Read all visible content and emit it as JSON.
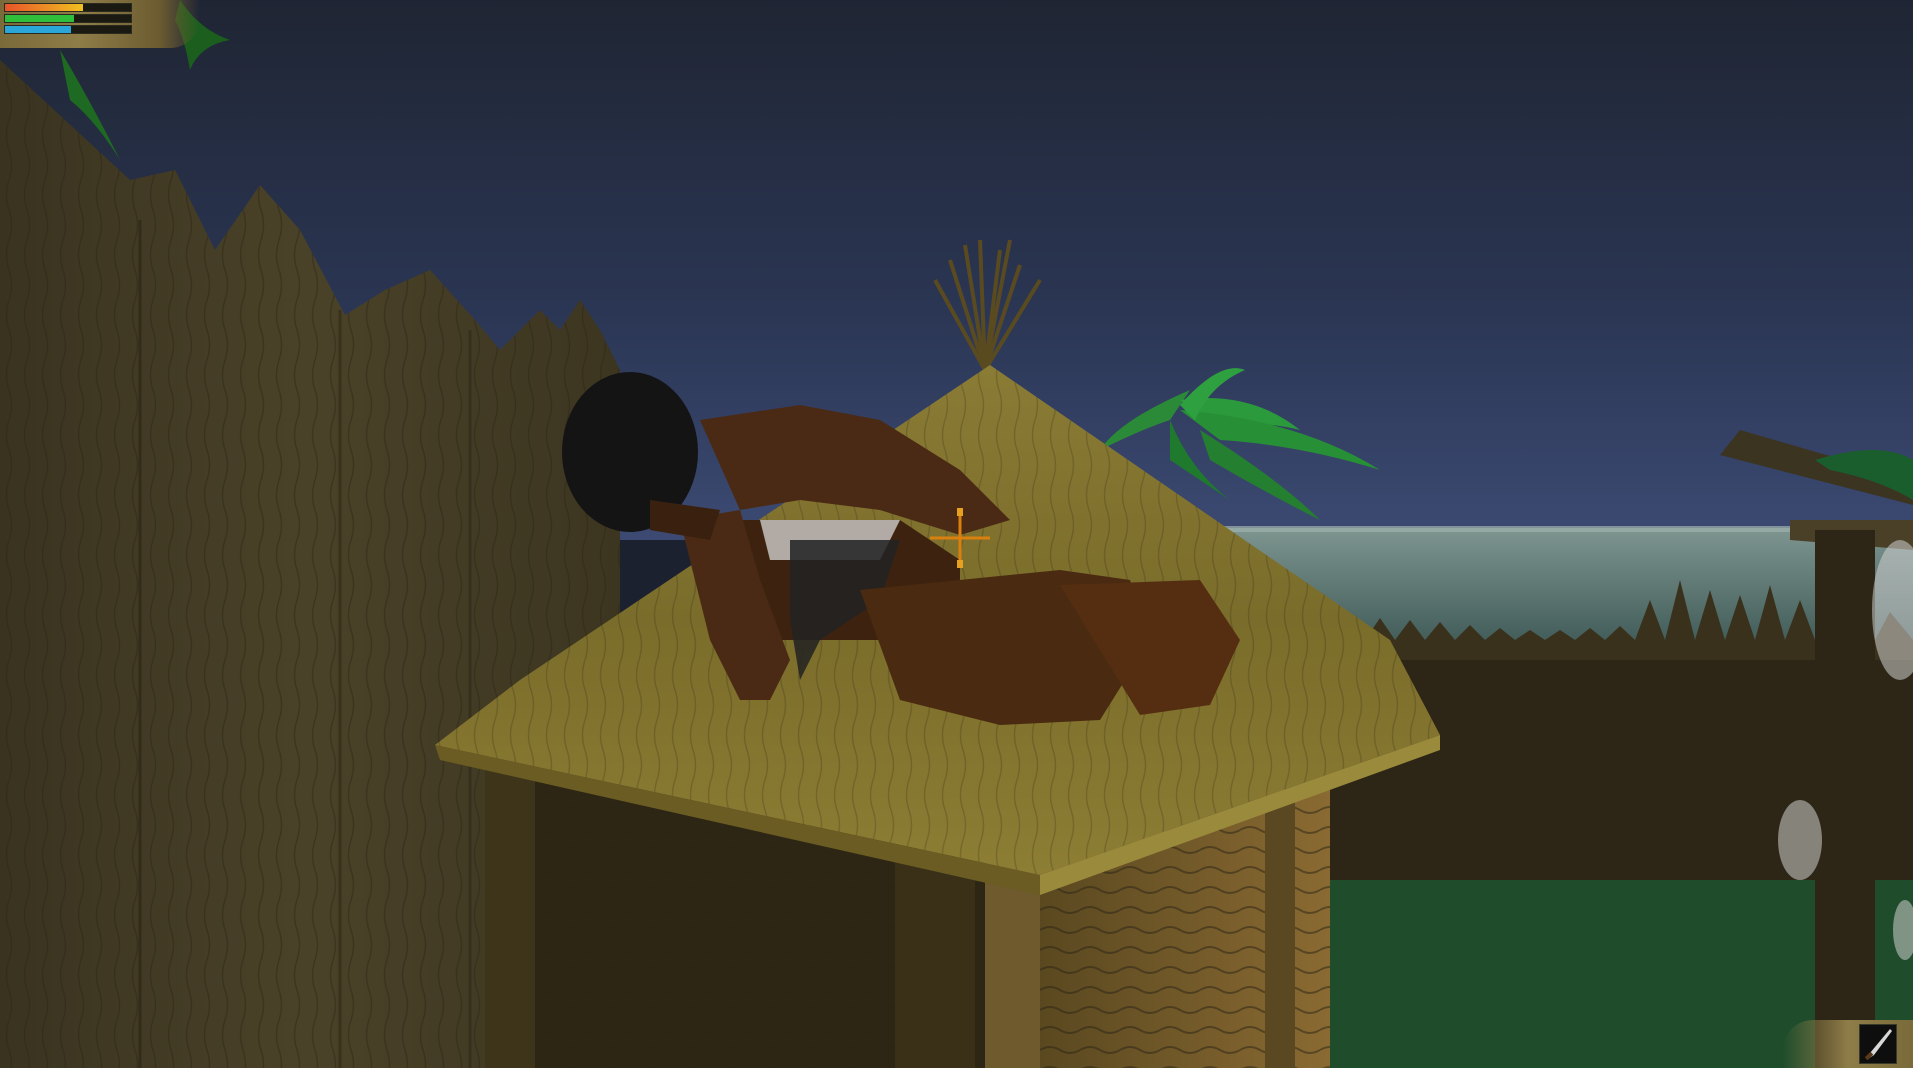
{
  "hud": {
    "bars": [
      {
        "name": "health",
        "color": "#e8542a",
        "color2": "#f0c020",
        "level": 0.62
      },
      {
        "name": "stamina",
        "color": "#2fbf3a",
        "level": 0.55
      },
      {
        "name": "water",
        "color": "#2aa6d8",
        "level": 0.52
      }
    ],
    "equipped_icon": "machete-icon"
  },
  "scene": {
    "time_of_day": "night",
    "elements": [
      "palisade-fence",
      "thatched-hut",
      "palm-tree",
      "ocean",
      "grass",
      "watchtower",
      "character-on-roof"
    ]
  }
}
